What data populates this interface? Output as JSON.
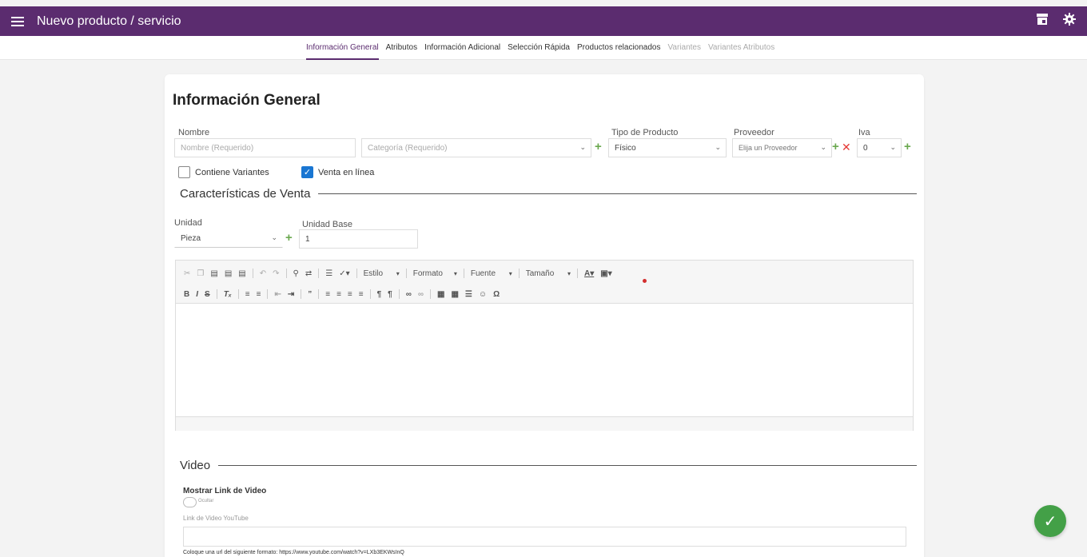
{
  "header": {
    "title": "Nuevo producto / servicio",
    "store_icon": "store-icon",
    "settings_icon": "gear-icon"
  },
  "tabs": [
    {
      "label": "Información General",
      "state": "active"
    },
    {
      "label": "Atributos",
      "state": "normal"
    },
    {
      "label": "Información Adicional",
      "state": "normal"
    },
    {
      "label": "Selección Rápida",
      "state": "normal"
    },
    {
      "label": "Productos relacionados",
      "state": "normal"
    },
    {
      "label": "Variantes",
      "state": "disabled"
    },
    {
      "label": "Variantes Atributos",
      "state": "disabled"
    }
  ],
  "form": {
    "title": "Información General",
    "nombre": {
      "label": "Nombre",
      "placeholder": "Nombre (Requerido)"
    },
    "categoria": {
      "placeholder": "Categoría (Requerido)"
    },
    "tipo_producto": {
      "label": "Tipo de Producto",
      "value": "Físico"
    },
    "proveedor": {
      "label": "Proveedor",
      "value": "Elija un Proveedor"
    },
    "iva": {
      "label": "Iva",
      "value": "0"
    },
    "contiene_variantes": {
      "label": "Contiene Variantes",
      "checked": false
    },
    "venta_en_linea": {
      "label": "Venta en línea",
      "checked": true
    }
  },
  "caracteristicas": {
    "title": "Características de Venta",
    "unidad": {
      "label": "Unidad",
      "value": "Pieza"
    },
    "unidad_base": {
      "label": "Unidad Base",
      "value": "1"
    }
  },
  "editor": {
    "estilo": "Estilo",
    "formato": "Formato",
    "fuente": "Fuente",
    "tamano": "Tamaño"
  },
  "video": {
    "title": "Video",
    "mostrar_label": "Mostrar Link de Video",
    "toggle_text": "Ocultar",
    "link_label": "Link de Video YouTube",
    "hint": "Coloque una url del siguiente formato: https://www.youtube.com/watch?v=LXb3EKWsInQ"
  },
  "colors": {
    "primary": "#5b2c6f",
    "success": "#43a047",
    "plus": "#6aa84f",
    "remove": "#e53935",
    "checkbox": "#1976d2"
  }
}
